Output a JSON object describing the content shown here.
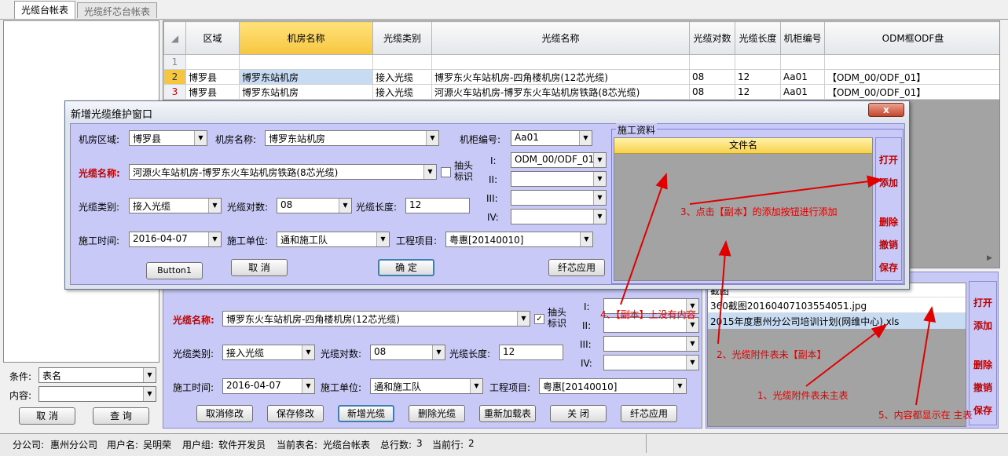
{
  "tabs": [
    "光缆台帐表",
    "光缆纤芯台帐表"
  ],
  "filter": {
    "cond_label": "条件:",
    "cond_value": "表名",
    "content_label": "内容:",
    "content_value": "",
    "cancel": "取 消",
    "query": "查 询"
  },
  "grid": {
    "headers": [
      "区域",
      "机房名称",
      "光缆类别",
      "光缆名称",
      "光缆对数",
      "光缆长度",
      "机柜编号",
      "ODM框ODF盘"
    ],
    "rows": [
      {
        "num": "1",
        "cells": [
          "",
          "",
          "",
          "",
          "",
          "",
          "",
          ""
        ]
      },
      {
        "num": "2",
        "cells": [
          "博罗县",
          "博罗东站机房",
          "接入光缆",
          "博罗东火车站机房-四角楼机房(12芯光缆)",
          "08",
          "12",
          "Aa01",
          "【ODM_00/ODF_01】"
        ]
      },
      {
        "num": "3",
        "cells": [
          "博罗县",
          "博罗东站机房",
          "接入光缆",
          "河源火车站机房-博罗东火车站机房铁路(8芯光缆)",
          "08",
          "12",
          "Aa01",
          "【ODM_00/ODF_01】"
        ]
      }
    ]
  },
  "dialog": {
    "title": "新增光缆维护窗口",
    "close": "x",
    "area_label": "机房区域:",
    "area_value": "博罗县",
    "room_label": "机房名称:",
    "room_value": "博罗东站机房",
    "cab_label": "机柜编号:",
    "cab_value": "Aa01",
    "cable_label": "光缆名称:",
    "cable_value": "河源火车站机房-博罗东火车站机房铁路(8芯光缆)",
    "pull_label": "抽头标识",
    "type_label": "光缆类别:",
    "type_value": "接入光缆",
    "pairs_label": "光缆对数:",
    "pairs_value": "08",
    "len_label": "光缆长度:",
    "len_value": "12",
    "time_label": "施工时间:",
    "time_value": "2016-04-07",
    "unit_label": "施工单位:",
    "unit_value": "通和施工队",
    "proj_label": "工程项目:",
    "proj_value": "粤惠[20140010]",
    "odm": [
      {
        "label": "I:",
        "value": "ODM_00/ODF_01"
      },
      {
        "label": "II:",
        "value": ""
      },
      {
        "label": "III:",
        "value": ""
      },
      {
        "label": "IV:",
        "value": ""
      }
    ],
    "btn1": "Button1",
    "cancel": "取 消",
    "ok": "确 定",
    "fiber": "纤芯应用",
    "doc_group": "施工资料",
    "doc_header": "文件名",
    "side": [
      "打开",
      "添加",
      "删除",
      "撤销",
      "保存"
    ]
  },
  "lower": {
    "cable_label": "光缆名称:",
    "cable_value": "博罗东火车站机房-四角楼机房(12芯光缆)",
    "pull_label": "抽头标识",
    "odm": [
      "I:",
      "II:",
      "III:",
      "IV:"
    ],
    "type_label": "光缆类别:",
    "type_value": "接入光缆",
    "pairs_label": "光缆对数:",
    "pairs_value": "08",
    "len_label": "光缆长度:",
    "len_value": "12",
    "time_label": "施工时间:",
    "time_value": "2016-04-07",
    "unit_label": "施工单位:",
    "unit_value": "通和施工队",
    "proj_label": "工程项目:",
    "proj_value": "粤惠[20140010]",
    "buttons": [
      "取消修改",
      "保存修改",
      "新增光缆",
      "删除光缆",
      "重新加载表",
      "关 闭",
      "纤芯应用"
    ]
  },
  "files": {
    "rows": [
      "截图",
      "360截图20160407103554051.jpg",
      "2015年度惠州分公司培训计划(网维中心).xls"
    ],
    "side": [
      "打开",
      "添加",
      "删除",
      "撤销",
      "保存"
    ]
  },
  "annotations": {
    "a1": "1、光缆附件表未主表",
    "a2": "2、光缆附件表未【副本】",
    "a3": "3、点击【副本】的添加按钮进行添加",
    "a4": "4、【副本】上没有内容",
    "a5": "5、内容都显示在 主表"
  },
  "status": {
    "branch_label": "分公司:",
    "branch": "惠州分公司",
    "user_label": "用户名:",
    "user": "吴明荣",
    "group_label": "用户组:",
    "group": "软件开发员",
    "table_label": "当前表名:",
    "table": "光缆台帐表",
    "total_label": "总行数:",
    "total": "3",
    "cur_label": "当前行:",
    "cur": "2"
  }
}
